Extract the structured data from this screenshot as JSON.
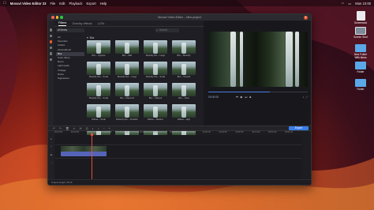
{
  "menubar": {
    "apple": "",
    "app_name": "Movavi Video Editor 23",
    "items": [
      "File",
      "Edit",
      "Playback",
      "Export",
      "Help"
    ],
    "right": "Mon 10:00"
  },
  "desktop": {
    "icons": [
      {
        "label": "Screenshot",
        "kind": "doc"
      },
      {
        "label": "Screen Shot",
        "kind": "shot"
      },
      {
        "label": "New Folder With Items",
        "kind": "folder"
      },
      {
        "label": "Folder",
        "kind": "folder"
      },
      {
        "label": "Folder",
        "kind": "folder"
      }
    ]
  },
  "window": {
    "title": "Movavi Video Editor – New project",
    "tabs": [
      "Filters",
      "Overlay effects",
      "LUTs"
    ],
    "filter_dropdown": "All items",
    "search_placeholder": "Search",
    "categories": [
      "All",
      "Favorites",
      "Artistic",
      "Atmospheric",
      "Blur",
      "Color filters",
      "Retro",
      "Light leaks",
      "Vintage",
      "Noise",
      "Signatures"
    ],
    "active_category": "Blur",
    "group_label": "Blur",
    "thumbs": [
      "Blur – Vignette",
      "Blur – Mild",
      "Butterfly blur – Large",
      "Blur – Butterfly",
      "Butterfly blur – Small",
      "Butterfly blur – Large",
      "Butterfly blur – Small",
      "Blur – Smooth",
      "Butterfly blur – Small",
      "Blur – Diamond",
      "Blur – Stained",
      "Blur – Glow",
      "Diffuse – Small",
      "Butterfly blur – Smallish",
      "Diffuse – Medium",
      "Diffuse – High",
      "Blur – Soft",
      "Blur – Medium",
      "Blur – Wide",
      "Blur – Strong"
    ],
    "player": {
      "timecode": "00:00:05",
      "progress": 0.62,
      "controls": [
        "prev",
        "play",
        "next",
        "stop"
      ]
    },
    "toolbar": {
      "export_label": "Export"
    },
    "ruler": [
      "00:00:00",
      "00:00:05",
      "00:00:10",
      "00:00:15",
      "00:00:20",
      "00:00:25",
      "00:00:30",
      "00:00:35",
      "00:00:40",
      "00:00:45",
      "00:00:50",
      "00:00:55",
      "00:01:00",
      "00:01:05",
      "00:01:10"
    ],
    "status": "Project length: 00:16"
  },
  "colors": {
    "accent": "#e8572e",
    "export": "#3b7de8",
    "clip": "#5564b8",
    "playhead": "#e84b3c"
  }
}
